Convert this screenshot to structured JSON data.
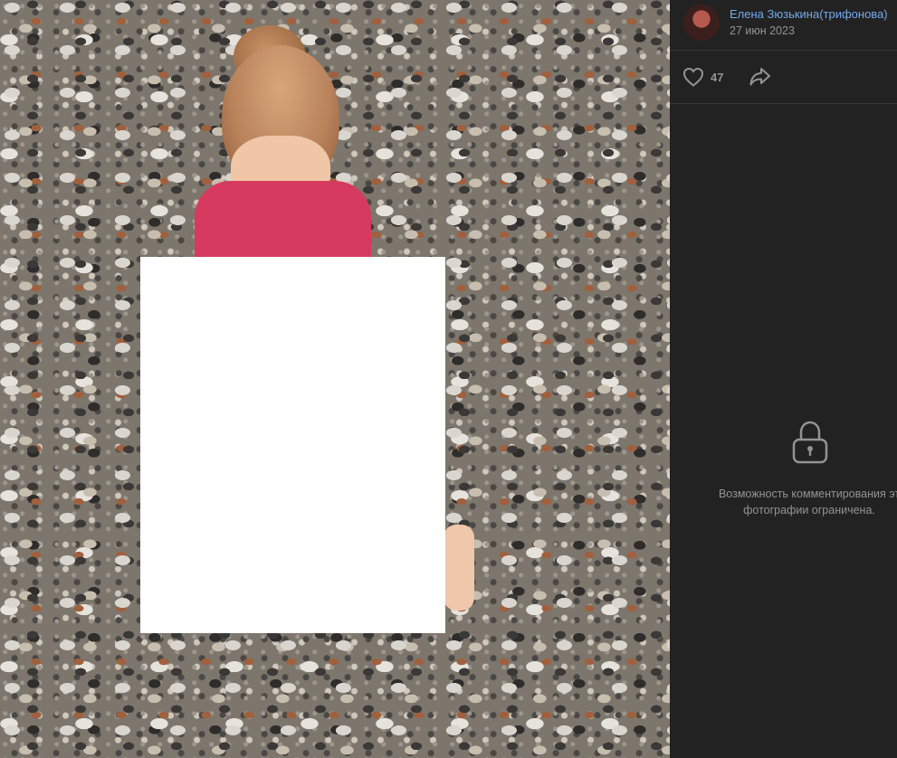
{
  "post": {
    "author_name": "Елена Зюзькина(трифонова)",
    "date": "27 июн 2023"
  },
  "actions": {
    "like_count": "47",
    "like_icon": "heart-icon",
    "share_icon": "share-arrow-icon"
  },
  "comments": {
    "lock_icon": "lock-icon",
    "restricted_text": "Возможность комментирования эт\nфотографии ограничена."
  },
  "colors": {
    "panel_bg": "#222222",
    "author_link": "#71aaeb",
    "muted_text": "#939393",
    "icon": "#939393",
    "divider": "#363738"
  }
}
